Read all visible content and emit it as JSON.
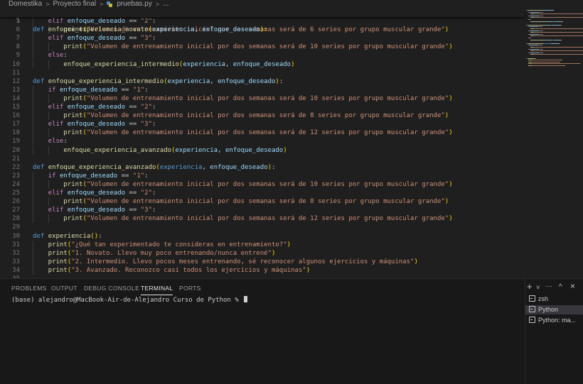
{
  "breadcrumb": {
    "items": [
      "Domestika",
      "Proyecto final",
      "pruebas.py",
      "..."
    ],
    "separator": ">"
  },
  "sticky": {
    "line_number": "1",
    "def": "def",
    "name": "enfoque_experiencia_novato",
    "open": "(",
    "p1": "experiencia",
    "comma": ", ",
    "p2": "enfoque_deseado",
    "close": "):"
  },
  "editor": {
    "lines": [
      {
        "n": "5",
        "indent": 1,
        "tokens": [
          [
            "kc",
            "elif "
          ],
          [
            "pr",
            "enfoque_deseado"
          ],
          [
            "pn",
            " == "
          ],
          [
            "st",
            "\"2\""
          ],
          [
            "pn",
            ":"
          ]
        ]
      },
      {
        "n": "6",
        "indent": 2,
        "tokens": [
          [
            "bl",
            "print"
          ],
          [
            "bk",
            "("
          ],
          [
            "st",
            "\"Volumen de entrenamiento inicial por dos semanas será de 6 series por grupo muscular grande\""
          ],
          [
            "bk",
            ")"
          ]
        ]
      },
      {
        "n": "7",
        "indent": 1,
        "tokens": [
          [
            "kc",
            "elif "
          ],
          [
            "pr",
            "enfoque_deseado"
          ],
          [
            "pn",
            " == "
          ],
          [
            "st",
            "\"3\""
          ],
          [
            "pn",
            ":"
          ]
        ]
      },
      {
        "n": "8",
        "indent": 2,
        "tokens": [
          [
            "bl",
            "print"
          ],
          [
            "bk",
            "("
          ],
          [
            "st",
            "\"Volumen de entrenamiento inicial por dos semanas será de 10 series por grupo muscular grande\""
          ],
          [
            "bk",
            ")"
          ]
        ]
      },
      {
        "n": "9",
        "indent": 1,
        "tokens": [
          [
            "kc",
            "else"
          ],
          [
            "pn",
            ":"
          ]
        ]
      },
      {
        "n": "10",
        "indent": 2,
        "tokens": [
          [
            "fn",
            "enfoque_experiencia_intermedio"
          ],
          [
            "bk",
            "("
          ],
          [
            "pr",
            "experiencia"
          ],
          [
            "pn",
            ", "
          ],
          [
            "pr",
            "enfoque_deseado"
          ],
          [
            "bk",
            ")"
          ]
        ]
      },
      {
        "n": "11",
        "indent": 0,
        "tokens": []
      },
      {
        "n": "12",
        "indent": 0,
        "tokens": [
          [
            "kw",
            "def "
          ],
          [
            "fn",
            "enfoque_experiencia_intermedio"
          ],
          [
            "bk",
            "("
          ],
          [
            "pr",
            "experiencia"
          ],
          [
            "pn",
            ", "
          ],
          [
            "pr",
            "enfoque_deseado"
          ],
          [
            "bk",
            ")"
          ],
          [
            "pn",
            ":"
          ]
        ]
      },
      {
        "n": "13",
        "indent": 1,
        "tokens": [
          [
            "kc",
            "if "
          ],
          [
            "pr",
            "enfoque_deseado"
          ],
          [
            "pn",
            " == "
          ],
          [
            "st",
            "\"1\""
          ],
          [
            "pn",
            ":"
          ]
        ]
      },
      {
        "n": "14",
        "indent": 2,
        "tokens": [
          [
            "bl",
            "print"
          ],
          [
            "bk",
            "("
          ],
          [
            "st",
            "\"Volumen de entrenamiento inicial por dos semanas será de 10 series por grupo muscular grande\""
          ],
          [
            "bk",
            ")"
          ]
        ]
      },
      {
        "n": "15",
        "indent": 1,
        "tokens": [
          [
            "kc",
            "elif "
          ],
          [
            "pr",
            "enfoque_deseado"
          ],
          [
            "pn",
            " == "
          ],
          [
            "st",
            "\"2\""
          ],
          [
            "pn",
            ":"
          ]
        ]
      },
      {
        "n": "16",
        "indent": 2,
        "tokens": [
          [
            "bl",
            "print"
          ],
          [
            "bk",
            "("
          ],
          [
            "st",
            "\"Volumen de entrenamiento inicial por dos semanas será de 8 series por grupo muscular grande\""
          ],
          [
            "bk",
            ")"
          ]
        ]
      },
      {
        "n": "17",
        "indent": 1,
        "tokens": [
          [
            "kc",
            "elif "
          ],
          [
            "pr",
            "enfoque_deseado"
          ],
          [
            "pn",
            " == "
          ],
          [
            "st",
            "\"3\""
          ],
          [
            "pn",
            ":"
          ]
        ]
      },
      {
        "n": "18",
        "indent": 2,
        "tokens": [
          [
            "bl",
            "print"
          ],
          [
            "bk",
            "("
          ],
          [
            "st",
            "\"Volumen de entrenamiento inicial por dos semanas será de 12 series por grupo muscular grande\""
          ],
          [
            "bk",
            ")"
          ]
        ]
      },
      {
        "n": "19",
        "indent": 1,
        "tokens": [
          [
            "kc",
            "else"
          ],
          [
            "pn",
            ":"
          ]
        ]
      },
      {
        "n": "20",
        "indent": 2,
        "tokens": [
          [
            "fn",
            "enfoque_experiencia_avanzado"
          ],
          [
            "bk",
            "("
          ],
          [
            "pr",
            "experiencia"
          ],
          [
            "pn",
            ", "
          ],
          [
            "pr",
            "enfoque_deseado"
          ],
          [
            "bk",
            ")"
          ]
        ]
      },
      {
        "n": "21",
        "indent": 0,
        "tokens": []
      },
      {
        "n": "22",
        "indent": 0,
        "tokens": [
          [
            "kw",
            "def "
          ],
          [
            "fn",
            "enfoque_experiencia_avanzado"
          ],
          [
            "bk",
            "("
          ],
          [
            "kw",
            "experiencia"
          ],
          [
            "pn",
            ", "
          ],
          [
            "pr",
            "enfoque_deseado"
          ],
          [
            "bk",
            ")"
          ],
          [
            "pn",
            ":"
          ]
        ]
      },
      {
        "n": "23",
        "indent": 1,
        "tokens": [
          [
            "kc",
            "if "
          ],
          [
            "pr",
            "enfoque_deseado"
          ],
          [
            "pn",
            " == "
          ],
          [
            "st",
            "\"1\""
          ],
          [
            "pn",
            ":"
          ]
        ]
      },
      {
        "n": "24",
        "indent": 2,
        "tokens": [
          [
            "bl",
            "print"
          ],
          [
            "bk",
            "("
          ],
          [
            "st",
            "\"Volumen de entrenamiento inicial por dos semanas será de 10 series por grupo muscular grande\""
          ],
          [
            "bk",
            ")"
          ]
        ]
      },
      {
        "n": "25",
        "indent": 1,
        "tokens": [
          [
            "kc",
            "elif "
          ],
          [
            "pr",
            "enfoque_deseado"
          ],
          [
            "pn",
            " == "
          ],
          [
            "st",
            "\"2\""
          ],
          [
            "pn",
            ":"
          ]
        ]
      },
      {
        "n": "26",
        "indent": 2,
        "tokens": [
          [
            "bl",
            "print"
          ],
          [
            "bk",
            "("
          ],
          [
            "st",
            "\"Volumen de entrenamiento inicial por dos semanas será de 8 series por grupo muscular grande\""
          ],
          [
            "bk",
            ")"
          ]
        ]
      },
      {
        "n": "27",
        "indent": 1,
        "tokens": [
          [
            "kc",
            "elif "
          ],
          [
            "pr",
            "enfoque_deseado"
          ],
          [
            "pn",
            " == "
          ],
          [
            "st",
            "\"3\""
          ],
          [
            "pn",
            ":"
          ]
        ]
      },
      {
        "n": "28",
        "indent": 2,
        "tokens": [
          [
            "bl",
            "print"
          ],
          [
            "bk",
            "("
          ],
          [
            "st",
            "\"Volumen de entrenamiento inicial por dos semanas será de 12 series por grupo muscular grande\""
          ],
          [
            "bk",
            ")"
          ]
        ]
      },
      {
        "n": "29",
        "indent": 0,
        "tokens": []
      },
      {
        "n": "30",
        "indent": 0,
        "tokens": [
          [
            "kw",
            "def "
          ],
          [
            "fn",
            "experiencia"
          ],
          [
            "bk",
            "("
          ],
          [
            "bk",
            ")"
          ],
          [
            "pn",
            ":"
          ]
        ]
      },
      {
        "n": "31",
        "indent": 1,
        "tokens": [
          [
            "bl",
            "print"
          ],
          [
            "bk",
            "("
          ],
          [
            "st",
            "\"¿Qué tan experimentado te consideras en entrenamiento?\""
          ],
          [
            "bk",
            ")"
          ]
        ]
      },
      {
        "n": "32",
        "indent": 1,
        "tokens": [
          [
            "bl",
            "print"
          ],
          [
            "bk",
            "("
          ],
          [
            "st",
            "\"1. Novato. Llevo muy poco entrenando/nunca entrené\""
          ],
          [
            "bk",
            ")"
          ]
        ]
      },
      {
        "n": "33",
        "indent": 1,
        "tokens": [
          [
            "bl",
            "print"
          ],
          [
            "bk",
            "("
          ],
          [
            "st",
            "\"2. Intermedio. Llevo pocos meses entrenando, sé reconocer algunos ejercicios y máquinas\""
          ],
          [
            "bk",
            ")"
          ]
        ]
      },
      {
        "n": "34",
        "indent": 1,
        "tokens": [
          [
            "bl",
            "print"
          ],
          [
            "bk",
            "("
          ],
          [
            "st",
            "\"3. Avanzado. Reconozco casi todos los ejercicios y máquinas\""
          ],
          [
            "bk",
            ")"
          ]
        ]
      },
      {
        "n": "35",
        "indent": 0,
        "tokens": []
      }
    ]
  },
  "panel": {
    "tabs": [
      {
        "label": "PROBLEMS",
        "active": false
      },
      {
        "label": "OUTPUT",
        "active": false
      },
      {
        "label": "DEBUG CONSOLE",
        "active": false
      },
      {
        "label": "TERMINAL",
        "active": true
      },
      {
        "label": "PORTS",
        "active": false
      }
    ],
    "controls": {
      "add": "+",
      "dropdown": "˅",
      "more": "···",
      "maximize": "^",
      "close": "×"
    },
    "prompt": "(base) alejandro@MacBook-Air-de-Alejandro Curso de Python % ",
    "terminals": [
      {
        "label": "zsh",
        "active": false
      },
      {
        "label": "Python",
        "active": true
      },
      {
        "label": "Python: ma...",
        "active": false
      }
    ]
  },
  "colors": {
    "background": "#1f1f1f",
    "panel": "#181818",
    "keyword": "#569cd6",
    "control": "#c586c0",
    "function": "#dcdcaa",
    "param": "#9cdcfe",
    "string": "#ce9178",
    "bracket": "#ffd700"
  }
}
